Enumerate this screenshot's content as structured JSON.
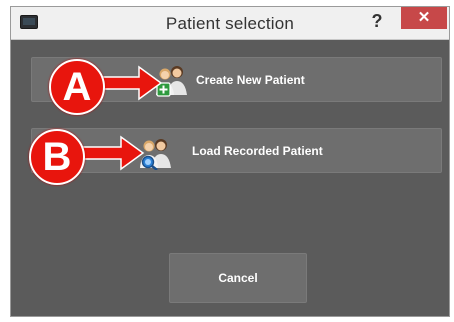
{
  "window": {
    "title": "Patient selection",
    "help_label": "?",
    "close_label": "✕"
  },
  "buttons": {
    "create_new": "Create New Patient",
    "load_recorded": "Load Recorded Patient",
    "cancel": "Cancel"
  },
  "annotations": {
    "a_label": "A",
    "b_label": "B"
  },
  "colors": {
    "dialog_bg": "#5b5b5b",
    "button_bg": "#6e6e6e",
    "close_red": "#c74849",
    "annotation_red": "#e8150d"
  },
  "icons": {
    "create_new": "add-patient-icon",
    "load_recorded": "search-patient-icon",
    "app": "monitor-icon"
  }
}
